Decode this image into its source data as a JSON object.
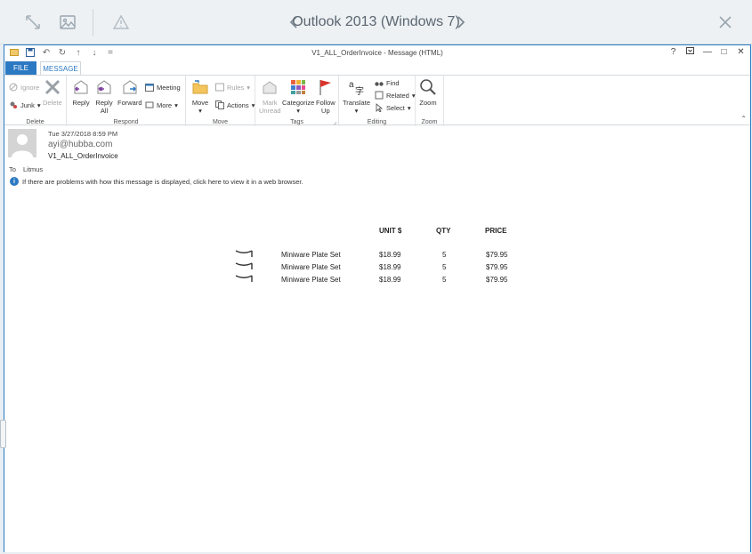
{
  "preview": {
    "title": "Outlook 2013 (Windows 7)",
    "icons": [
      "expand-icon",
      "image-icon",
      "warning-icon",
      "close-icon"
    ]
  },
  "window": {
    "title": "V1_ALL_OrderInvoice - Message (HTML)",
    "controls": {
      "help": "?",
      "restore": "",
      "minimize": "—",
      "maximize": "□",
      "close": "✕"
    }
  },
  "tabs": {
    "file": "FILE",
    "message": "MESSAGE"
  },
  "ribbon": {
    "delete_group": {
      "label": "Delete",
      "ignore": "Ignore",
      "junk": "Junk",
      "delete": "Delete"
    },
    "respond_group": {
      "label": "Respond",
      "reply": "Reply",
      "reply_all_1": "Reply",
      "reply_all_2": "All",
      "forward": "Forward",
      "meeting": "Meeting",
      "more": "More"
    },
    "move_group": {
      "label": "Move",
      "move": "Move",
      "rules": "Rules",
      "actions": "Actions"
    },
    "tags_group": {
      "label": "Tags",
      "mark_1": "Mark",
      "mark_2": "Unread",
      "categorize": "Categorize",
      "follow_1": "Follow",
      "follow_2": "Up"
    },
    "editing_group": {
      "label": "Editing",
      "translate": "Translate",
      "find": "Find",
      "related": "Related",
      "select": "Select"
    },
    "zoom_group": {
      "label": "Zoom",
      "zoom": "Zoom"
    }
  },
  "message": {
    "date": "Tue 3/27/2018 8:59 PM",
    "from": "ayi@hubba.com",
    "subject": "V1_ALL_OrderInvoice",
    "to_label": "To",
    "to": "Litmus",
    "info": "If there are problems with how this message is displayed, click here to view it in a web browser."
  },
  "invoice": {
    "headers": {
      "unit": "UNIT $",
      "qty": "QTY",
      "price": "PRICE"
    },
    "rows": [
      {
        "item": "Miniware Plate Set",
        "unit": "$18.99",
        "qty": "5",
        "price": "$79.95"
      },
      {
        "item": "Miniware Plate Set",
        "unit": "$18.99",
        "qty": "5",
        "price": "$79.95"
      },
      {
        "item": "Miniware Plate Set",
        "unit": "$18.99",
        "qty": "5",
        "price": "$79.95"
      }
    ]
  }
}
